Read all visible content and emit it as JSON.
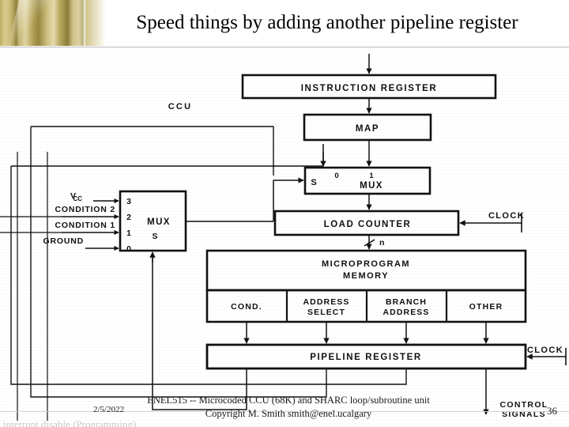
{
  "slide": {
    "title": "Speed things by adding another pipeline register",
    "number": "36"
  },
  "footer": {
    "date": "2/5/2022",
    "line1": "ENEL515 -- Microcoded CCU (68K) and SHARC loop/subroutine unit",
    "line2": "Copyright M. Smith smith@enel.ucalgary",
    "cut_off_text": "interrupt disable (Programming)"
  },
  "diagram": {
    "unit_label": "CCU",
    "blocks": {
      "instruction_register": "INSTRUCTION REGISTER",
      "map": "MAP",
      "address_mux": "MUX",
      "load_counter": "LOAD COUNTER",
      "microprogram_memory_line1": "MICROPROGRAM",
      "microprogram_memory_line2": "MEMORY",
      "condition_mux": "MUX",
      "pipeline_register": "PIPELINE REGISTER"
    },
    "memory_fields": [
      "COND.",
      "ADDRESS SELECT",
      "BRANCH ADDRESS",
      "OTHER"
    ],
    "memory_fields_split": [
      {
        "line1": "COND.",
        "line2": ""
      },
      {
        "line1": "ADDRESS",
        "line2": "SELECT"
      },
      {
        "line1": "BRANCH",
        "line2": "ADDRESS"
      },
      {
        "line1": "OTHER",
        "line2": ""
      }
    ],
    "condition_mux_inputs": [
      {
        "signal": "VCC",
        "port": "3"
      },
      {
        "signal": "CONDITION 2",
        "port": "2"
      },
      {
        "signal": "CONDITION 1",
        "port": "1"
      },
      {
        "signal": "GROUND",
        "port": "0"
      }
    ],
    "condition_mux_select": "S",
    "address_mux_ports": {
      "select": "S",
      "input0": "0",
      "input1": "1"
    },
    "signals": {
      "clock_counter": "CLOCK",
      "clock_pipeline": "CLOCK",
      "control_signals_line1": "CONTROL",
      "control_signals_line2": "SIGNALS",
      "bus_width": "n"
    }
  },
  "colors": {
    "ink": "#111111",
    "paper": "#ffffff",
    "gold": "#bfae62",
    "rule": "#b9b9b9"
  }
}
